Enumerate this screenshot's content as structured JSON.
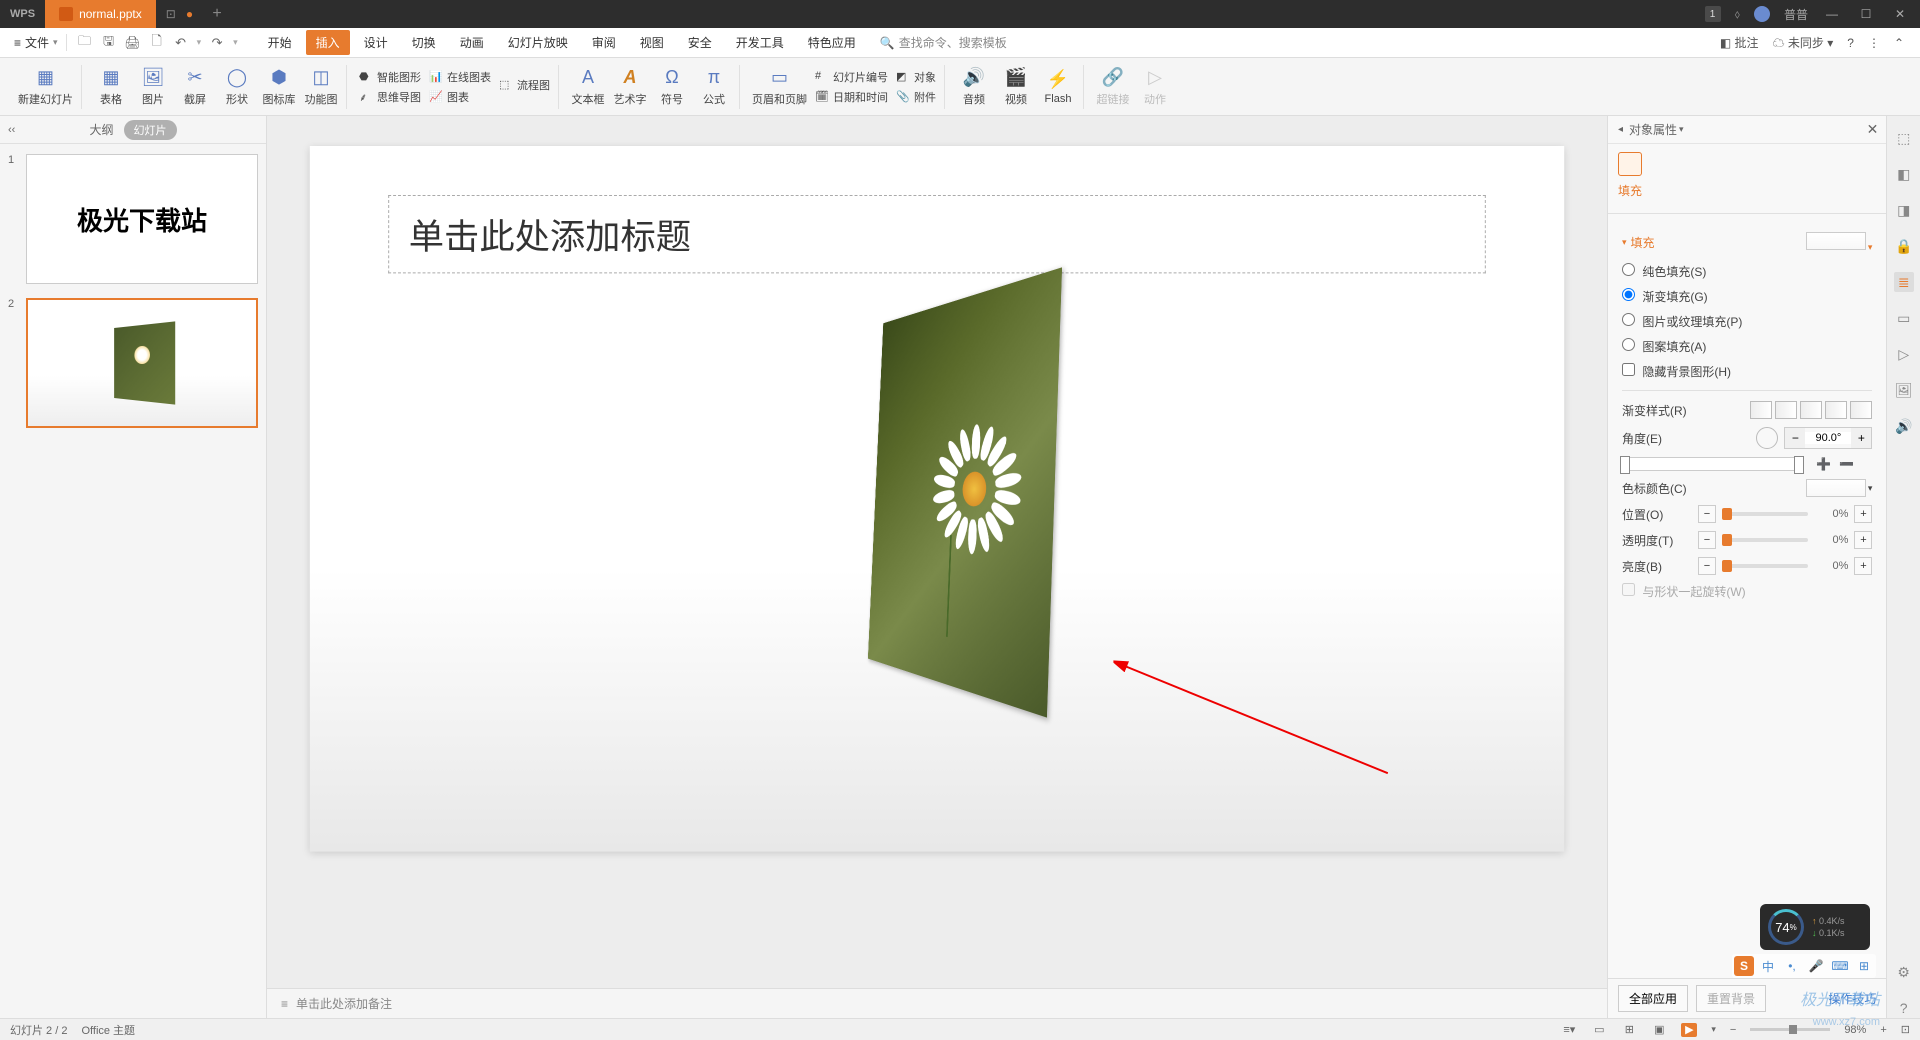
{
  "titlebar": {
    "app": "WPS",
    "tab_filename": "normal.pptx",
    "badge": "1",
    "user": "普普"
  },
  "menu": {
    "file": "文件",
    "tabs": [
      "开始",
      "插入",
      "设计",
      "切换",
      "动画",
      "幻灯片放映",
      "审阅",
      "视图",
      "安全",
      "开发工具",
      "特色应用"
    ],
    "active_index": 1,
    "search_placeholder": "查找命令、搜索模板",
    "comments": "批注",
    "sync": "未同步"
  },
  "ribbon": {
    "new_slide": "新建幻灯片",
    "table": "表格",
    "picture": "图片",
    "screenshot": "截屏",
    "shape": "形状",
    "icon_lib": "图标库",
    "func_diagram": "功能图",
    "smartart": "智能图形",
    "online_chart": "在线图表",
    "flowchart": "流程图",
    "mindmap": "思维导图",
    "chart": "图表",
    "textbox": "文本框",
    "wordart": "艺术字",
    "symbol": "符号",
    "formula": "公式",
    "header_footer": "页眉和页脚",
    "slide_number": "幻灯片编号",
    "datetime": "日期和时间",
    "object": "对象",
    "attachment": "附件",
    "audio": "音频",
    "video": "视频",
    "flash": "Flash",
    "hyperlink": "超链接",
    "action": "动作"
  },
  "thumb": {
    "outline": "大纲",
    "slide": "幻灯片",
    "slide1_text": "极光下载站"
  },
  "canvas": {
    "title_placeholder": "单击此处添加标题",
    "notes_placeholder": "单击此处添加备注"
  },
  "properties": {
    "panel_title": "对象属性",
    "tab_fill": "填充",
    "section_fill": "填充",
    "solid": "纯色填充(S)",
    "gradient": "渐变填充(G)",
    "picture": "图片或纹理填充(P)",
    "pattern": "图案填充(A)",
    "hide_bg": "隐藏背景图形(H)",
    "grad_style": "渐变样式(R)",
    "angle": "角度(E)",
    "angle_val": "90.0°",
    "stop_color": "色标颜色(C)",
    "position": "位置(O)",
    "position_val": "0%",
    "transparency": "透明度(T)",
    "transparency_val": "0%",
    "brightness": "亮度(B)",
    "brightness_val": "0%",
    "rotate_with_shape": "与形状一起旋转(W)",
    "apply_all": "全部应用",
    "reset_bg": "重置背景",
    "tips": "操作技巧"
  },
  "status": {
    "slide_info": "幻灯片 2 / 2",
    "theme": "Office 主题",
    "zoom": "98%"
  },
  "gauge": {
    "pct": "74",
    "up": "0.4K/s",
    "down": "0.1K/s"
  },
  "ime": {
    "char": "中"
  },
  "watermark": {
    "text": "极光下载站",
    "url": "www.xz7.com"
  }
}
